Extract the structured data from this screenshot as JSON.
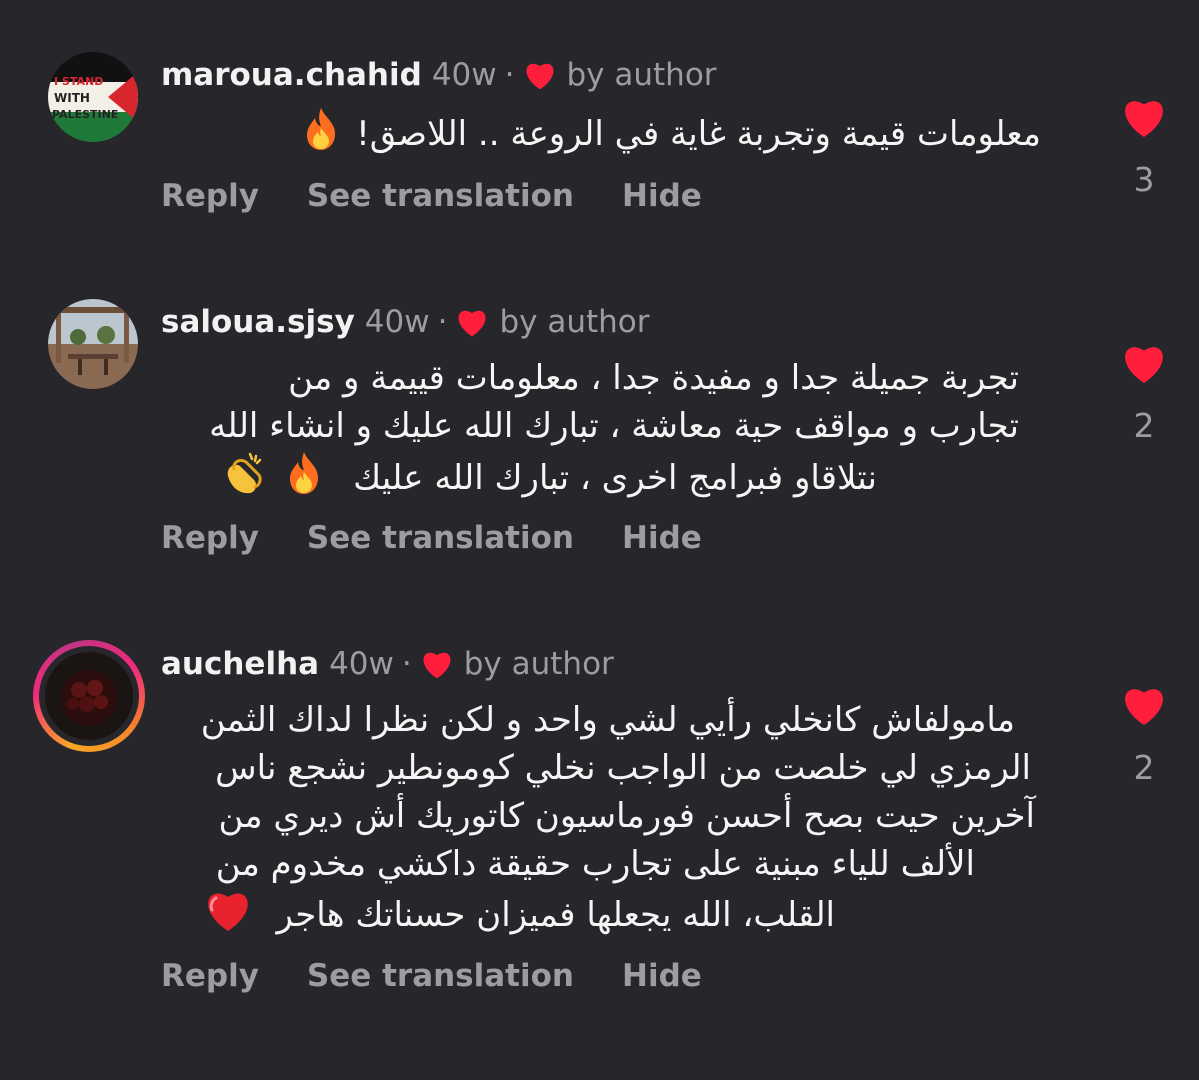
{
  "colors": {
    "background": "#26262b",
    "heart": "#ff1f3d",
    "muted": "#9c9ca3",
    "text": "#f5f5f5"
  },
  "comments": [
    {
      "username": "maroua.chahid",
      "time": "40w",
      "separator": "·",
      "liked_by": "by author",
      "text": "معلومات قيمة وتجربة غاية في الروعة .. اللاصق!",
      "emojis": [
        "fire-emoji"
      ],
      "avatar_text": [
        "I STAND",
        "WITH",
        "PALESTINE"
      ],
      "actions": [
        "Reply",
        "See translation",
        "Hide"
      ],
      "like_count": "3"
    },
    {
      "username": "saloua.sjsy",
      "time": "40w",
      "separator": "·",
      "liked_by": "by author",
      "text_lines": [
        "تجربة جميلة جدا و مفيدة جدا ، معلومات قييمة و من",
        "تجارب و مواقف حية معاشة ، تبارك الله عليك و انشاء الله",
        "نتلاقاو فبرامج اخرى ، تبارك الله عليك"
      ],
      "emojis": [
        "fire-emoji",
        "clapping-hands-emoji"
      ],
      "actions": [
        "Reply",
        "See translation",
        "Hide"
      ],
      "like_count": "2"
    },
    {
      "username": "auchelha",
      "time": "40w",
      "separator": "·",
      "liked_by": "by author",
      "text_lines": [
        "مامولفاش كانخلي رأيي لشي واحد و لكن نظرا لداك الثمن",
        "الرمزي لي خلصت من الواجب نخلي كومونطير نشجع ناس",
        "آخرين حيت بصح أحسن فورماسيون كاتوريك أش ديري من",
        "الألف للياء مبنية على تجارب حقيقة داكشي مخدوم من",
        "القلب، الله يجعلها فميزان حسناتك هاجر"
      ],
      "emojis": [
        "red-heart-emoji"
      ],
      "actions": [
        "Reply",
        "See translation",
        "Hide"
      ],
      "like_count": "2"
    }
  ]
}
